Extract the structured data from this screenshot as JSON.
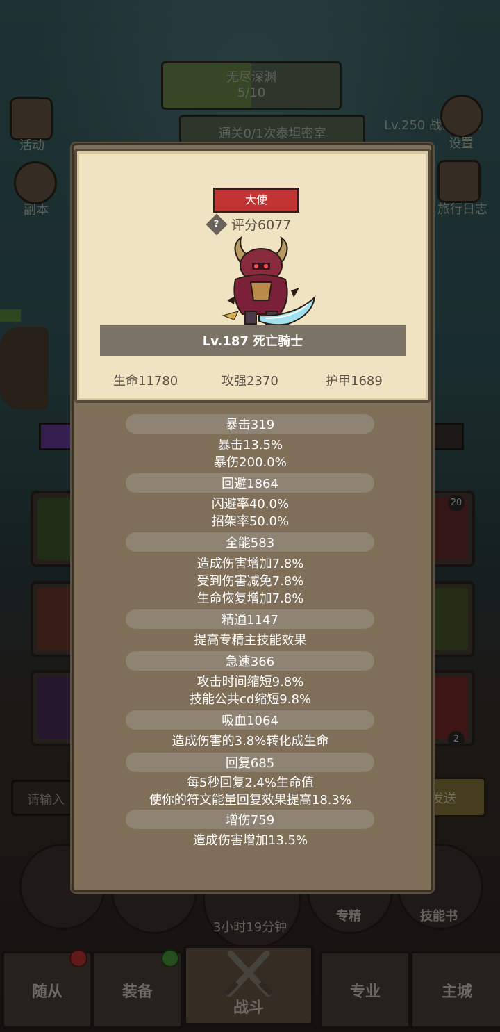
{
  "background": {
    "dungeon_title": "无尽深渊",
    "dungeon_progress": "5/10",
    "quest_text": "通关0/1次泰坦密室",
    "player_level": "Lv.250 战士:bao",
    "side_left": [
      "活动",
      "副本"
    ],
    "side_right": [
      "设置",
      "旅行日志"
    ],
    "slot_badges": [
      "20",
      "2"
    ],
    "chat_placeholder": "请输入",
    "send_label": "发送",
    "action_buttons": [
      "专精",
      "技能书"
    ],
    "timer": "3小时19分钟",
    "nav_tabs": [
      "随从",
      "装备",
      "战斗",
      "专业",
      "主城"
    ],
    "colors": {
      "accent_red": "#c23434",
      "card_bg": "#f0e3c1",
      "panel_bg": "#7f6f58"
    }
  },
  "popup": {
    "tier_badge": "大使",
    "score": "评分6077",
    "help_icon": "?",
    "unit_name": "Lv.187 死亡骑士",
    "base_stats": {
      "hp": "生命11780",
      "attack": "攻强2370",
      "armor": "护甲1689"
    },
    "groups": [
      {
        "title": "暴击319",
        "lines": [
          "暴击13.5%",
          "暴伤200.0%"
        ]
      },
      {
        "title": "回避1864",
        "lines": [
          "闪避率40.0%",
          "招架率50.0%"
        ]
      },
      {
        "title": "全能583",
        "lines": [
          "造成伤害增加7.8%",
          "受到伤害减免7.8%",
          "生命恢复增加7.8%"
        ]
      },
      {
        "title": "精通1147",
        "lines": [
          "提高专精主技能效果"
        ]
      },
      {
        "title": "急速366",
        "lines": [
          "攻击时间缩短9.8%",
          "技能公共cd缩短9.8%"
        ]
      },
      {
        "title": "吸血1064",
        "lines": [
          "造成伤害的3.8%转化成生命"
        ]
      },
      {
        "title": "回复685",
        "lines": [
          "每5秒回复2.4%生命值",
          "使你的符文能量回复效果提高18.3%"
        ]
      },
      {
        "title": "增伤759",
        "lines": [
          "造成伤害增加13.5%"
        ]
      }
    ]
  }
}
